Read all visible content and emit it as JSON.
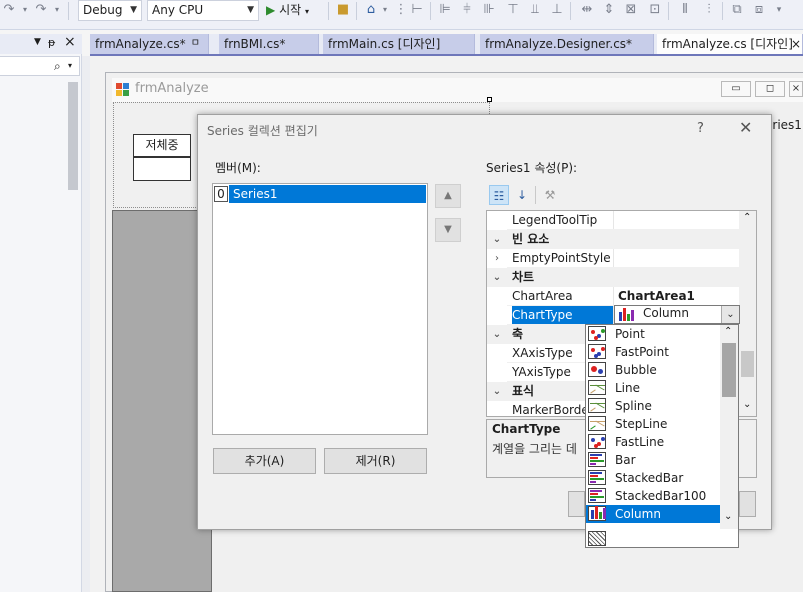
{
  "toolbar": {
    "config": "Debug",
    "platform": "Any CPU",
    "start_label": "시작"
  },
  "tabs": [
    {
      "label": "frmAnalyze.cs*",
      "pin": "ㅁ"
    },
    {
      "label": "frnBMI.cs*"
    },
    {
      "label": "frmMain.cs [디자인]"
    },
    {
      "label": "frmAnalyze.Designer.cs*"
    },
    {
      "label": "frmAnalyze.cs [디자인]",
      "close": "×"
    }
  ],
  "designer": {
    "form_title": "frmAnalyze",
    "weight_label": "저체중",
    "series_fragment": "eries1"
  },
  "dialog": {
    "title": "Series 컬렉션 편집기",
    "help": "?",
    "close": "✕",
    "members_label": "멤버(M):",
    "props_label": "Series1 속성(P):",
    "member_index": "0",
    "member_name": "Series1",
    "add_button": "추가(A)",
    "remove_button": "제거(R)"
  },
  "property_grid": {
    "rows": [
      {
        "type": "prop",
        "name": "LegendToolTip",
        "value": ""
      },
      {
        "type": "cat",
        "name": "빈 요소"
      },
      {
        "type": "prop",
        "name": "EmptyPointStyle",
        "value": "",
        "expander": "›"
      },
      {
        "type": "cat",
        "name": "차트"
      },
      {
        "type": "prop",
        "name": "ChartArea",
        "value": "ChartArea1"
      },
      {
        "type": "prop",
        "name": "ChartType",
        "value": "Column",
        "selected": true
      },
      {
        "type": "cat",
        "name": "축"
      },
      {
        "type": "prop",
        "name": "XAxisType",
        "value": ""
      },
      {
        "type": "prop",
        "name": "YAxisType",
        "value": ""
      },
      {
        "type": "cat",
        "name": "표식"
      },
      {
        "type": "prop",
        "name": "MarkerBorderColor",
        "value": ""
      }
    ],
    "desc_title": "ChartType",
    "desc_text": "계열을 그리는 데"
  },
  "chart_type_dropdown": {
    "selected": "Column",
    "items": [
      "Point",
      "FastPoint",
      "Bubble",
      "Line",
      "Spline",
      "StepLine",
      "FastLine",
      "Bar",
      "StackedBar",
      "StackedBar100",
      "Column"
    ]
  },
  "colors": {
    "selection": "#0078d7",
    "tab_accent": "#6e77ba"
  }
}
